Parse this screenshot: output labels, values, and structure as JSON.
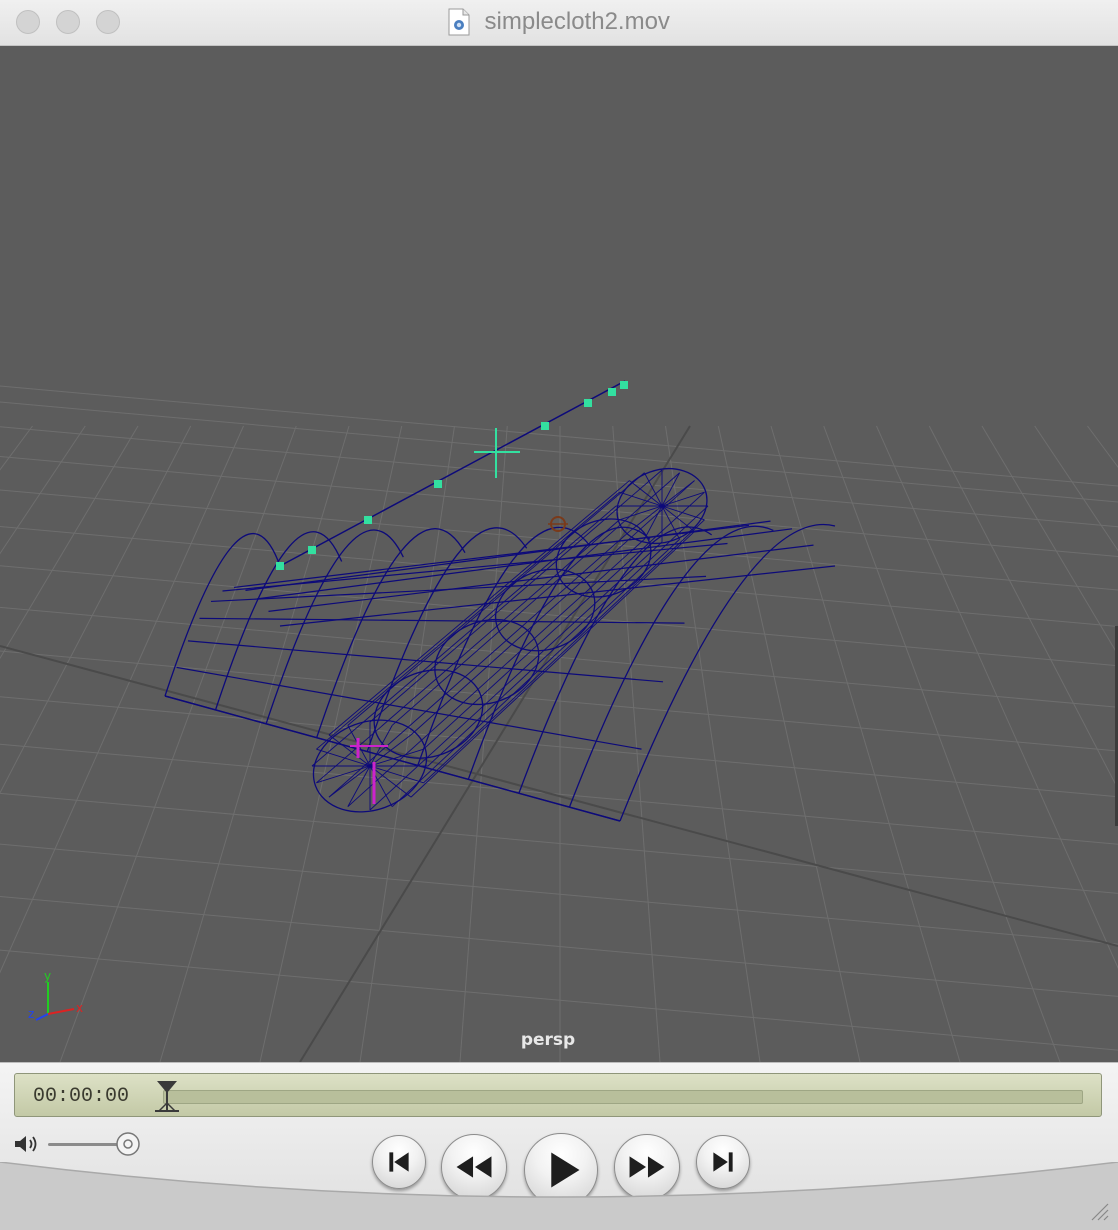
{
  "window": {
    "title": "simplecloth2.mov",
    "file_icon": "quicktime-document-icon"
  },
  "viewport": {
    "camera_label": "persp",
    "axis": {
      "y": "y",
      "x": "x",
      "z": "z"
    }
  },
  "controller": {
    "timecode": "00:00:00",
    "playback_position": 0,
    "volume_level": 1.0,
    "buttons": [
      {
        "name": "go-to-start",
        "icon": "skip-start-icon"
      },
      {
        "name": "rewind",
        "icon": "rewind-icon"
      },
      {
        "name": "play",
        "icon": "play-icon"
      },
      {
        "name": "fast-forward",
        "icon": "fast-forward-icon"
      },
      {
        "name": "go-to-end",
        "icon": "skip-end-icon"
      }
    ]
  },
  "colors": {
    "wireframe": "#0d0a7a",
    "selection": "#33e0a0",
    "locator": "#cc22cc",
    "grid": "#6e6e6e",
    "viewport_bg": "#5c5c5c",
    "lcd": "#cfd4b4"
  }
}
